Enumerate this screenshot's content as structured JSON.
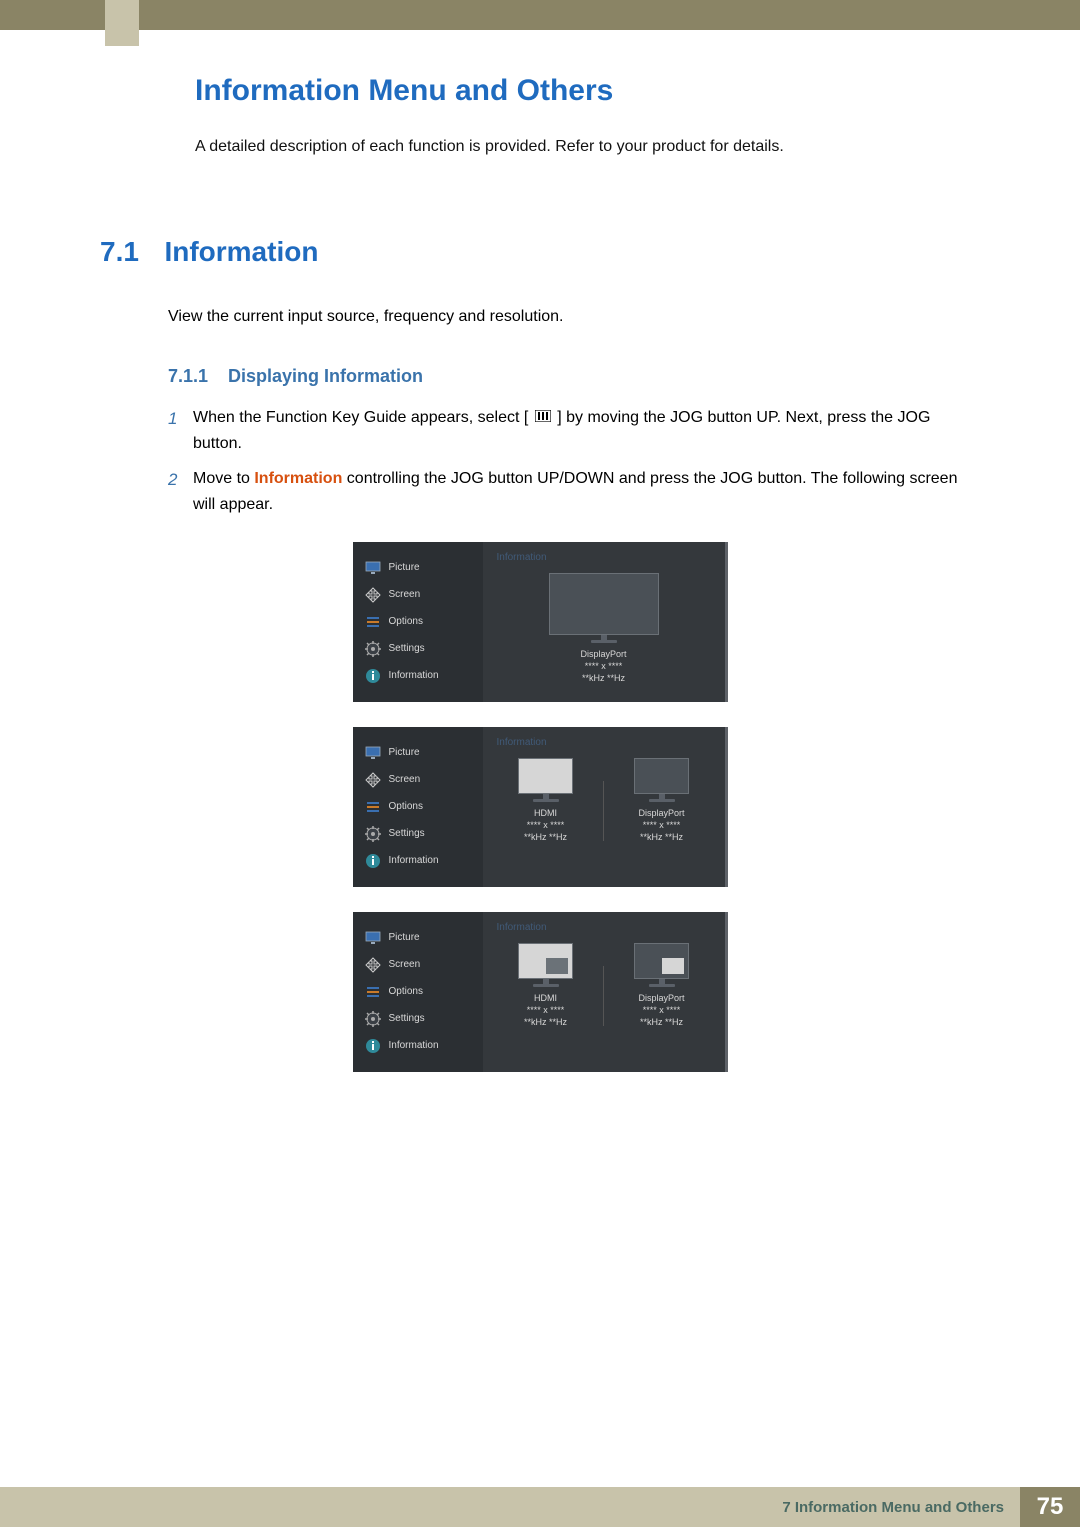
{
  "chapter_title": "Information Menu and Others",
  "intro": "A detailed description of each function is provided. Refer to your product for details.",
  "section": {
    "number": "7.1",
    "title": "Information",
    "desc": "View the current input source, frequency and resolution."
  },
  "subsection": {
    "number": "7.1.1",
    "title": "Displaying Information"
  },
  "steps": [
    {
      "num": "1",
      "pre": "When the Function Key Guide appears, select [",
      "post": "] by moving the JOG button UP. Next, press the JOG button."
    },
    {
      "num": "2",
      "full_pre": "Move to ",
      "highlight": "Information",
      "full_post": " controlling the JOG button UP/DOWN and press the JOG button. The following screen will appear."
    }
  ],
  "osd": {
    "menu": [
      "Picture",
      "Screen",
      "Options",
      "Settings",
      "Information"
    ],
    "right_title": "Information",
    "port_display": "DisplayPort",
    "port_hdmi": "HDMI",
    "res": "**** x ****",
    "freq": "**kHz **Hz"
  },
  "footer": {
    "label": "7 Information Menu and Others",
    "page": "75"
  }
}
